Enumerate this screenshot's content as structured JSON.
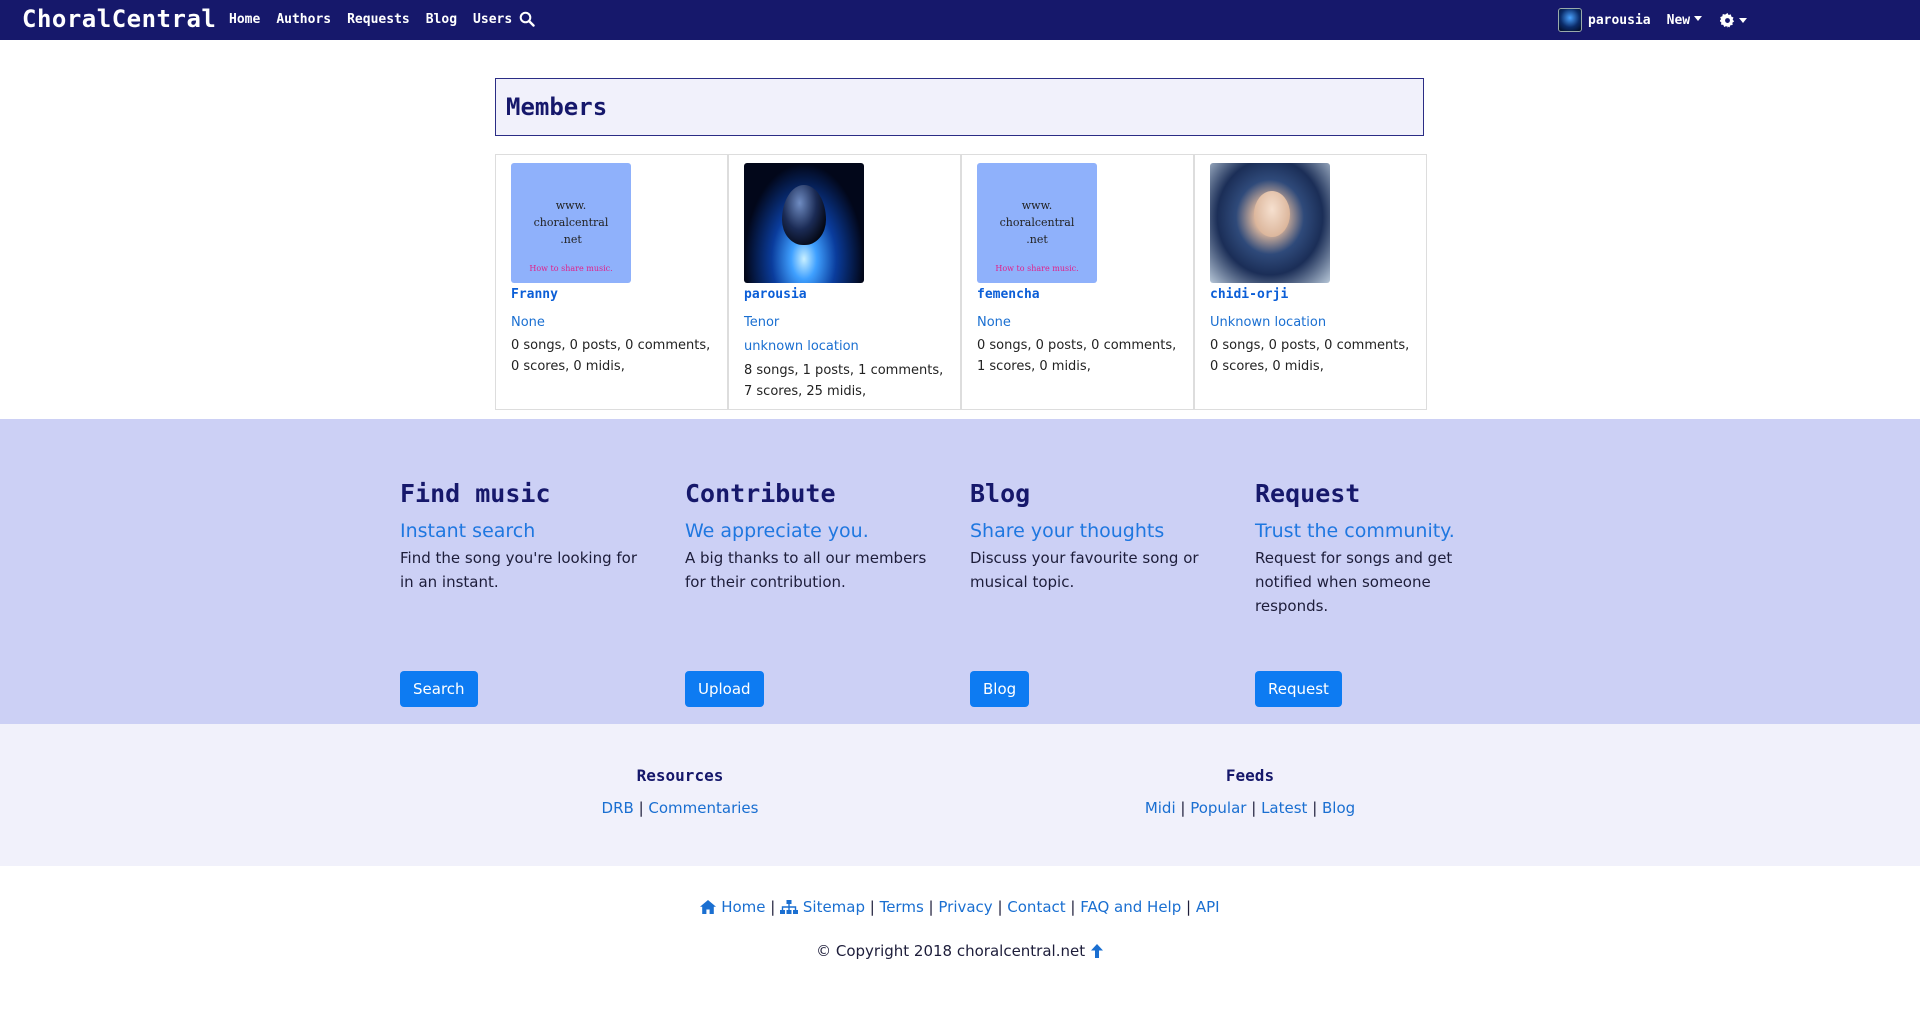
{
  "nav": {
    "brand": "ChoralCentral",
    "links": [
      "Home",
      "Authors",
      "Requests",
      "Blog",
      "Users"
    ],
    "username": "parousia",
    "new_label": "New"
  },
  "page_title": "Members",
  "members": [
    {
      "name": "Franny",
      "voice": "None",
      "location": "",
      "stats": "0 songs, 0 posts, 0 comments, 0 scores, 0 midis,",
      "avatar_text": [
        "www.",
        "choralcentral",
        ".net"
      ],
      "avatar_tagline": "How to share music."
    },
    {
      "name": "parousia",
      "voice": "Tenor",
      "location": "unknown location",
      "stats": "8 songs, 1 posts, 1 comments, 7 scores, 25 midis,"
    },
    {
      "name": "femencha",
      "voice": "None",
      "location": "",
      "stats": "0 songs, 0 posts, 0 comments, 1 scores, 0 midis,",
      "avatar_text": [
        "www.",
        "choralcentral",
        ".net"
      ],
      "avatar_tagline": "How to share music."
    },
    {
      "name": "chidi-orji",
      "voice": "Unknown location",
      "location": "",
      "stats": "0 songs, 0 posts, 0 comments, 0 scores, 0 midis,"
    }
  ],
  "features": [
    {
      "title": "Find music",
      "subtitle": "Instant search",
      "desc": "Find the song you're looking for in an instant.",
      "button": "Search"
    },
    {
      "title": "Contribute",
      "subtitle": "We appreciate you.",
      "desc": "A big thanks to all our members for their contribution.",
      "button": "Upload"
    },
    {
      "title": "Blog",
      "subtitle": "Share your thoughts",
      "desc": "Discuss your favourite song or musical topic.",
      "button": "Blog"
    },
    {
      "title": "Request",
      "subtitle": "Trust the community.",
      "desc": "Request for songs and get notified when someone responds.",
      "button": "Request"
    }
  ],
  "resources": {
    "title": "Resources",
    "links": [
      "DRB",
      "Commentaries"
    ]
  },
  "feeds": {
    "title": "Feeds",
    "links": [
      "Midi",
      "Popular",
      "Latest",
      "Blog"
    ]
  },
  "footer": {
    "links": [
      "Home",
      "Sitemap",
      "Terms",
      "Privacy",
      "Contact",
      "FAQ and Help",
      "API"
    ],
    "copyright": "© Copyright 2018 choralcentral.net"
  },
  "colors": {
    "navbar": "#16186b",
    "features_bg": "#ccd0f5",
    "button": "#0d7bf2",
    "link": "#1a6fd1"
  }
}
